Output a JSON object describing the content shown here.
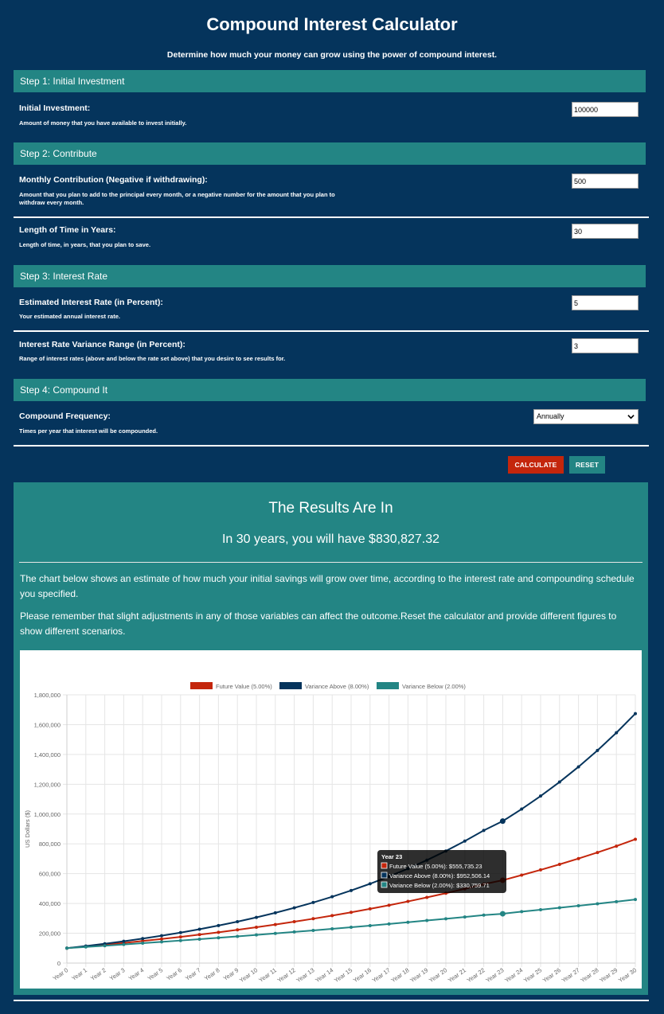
{
  "header": {
    "title": "Compound Interest Calculator",
    "subtitle": "Determine how much your money can grow using the power of compound interest."
  },
  "steps": {
    "step1": "Step 1: Initial Investment",
    "step2": "Step 2: Contribute",
    "step3": "Step 3: Interest Rate",
    "step4": "Step 4: Compound It"
  },
  "fields": {
    "initial_investment": {
      "label": "Initial Investment:",
      "desc": "Amount of money that you have available to invest initially.",
      "value": "100000"
    },
    "monthly_contribution": {
      "label": "Monthly Contribution (Negative if withdrawing):",
      "desc": "Amount that you plan to add to the principal every month, or a negative number for the amount that you plan to withdraw every month.",
      "value": "500"
    },
    "years": {
      "label": "Length of Time in Years:",
      "desc": "Length of time, in years, that you plan to save.",
      "value": "30"
    },
    "interest_rate": {
      "label": "Estimated Interest Rate (in Percent):",
      "desc": "Your estimated annual interest rate.",
      "value": "5"
    },
    "variance": {
      "label": "Interest Rate Variance Range (in Percent):",
      "desc": "Range of interest rates (above and below the rate set above) that you desire to see results for.",
      "value": "3"
    },
    "frequency": {
      "label": "Compound Frequency:",
      "desc": "Times per year that interest will be compounded.",
      "value": "Annually"
    }
  },
  "buttons": {
    "calculate": "CALCULATE",
    "reset": "RESET"
  },
  "results": {
    "title": "The Results Are In",
    "summary": "In 30 years, you will have $830,827.32",
    "paragraph1": "The chart below shows an estimate of how much your initial savings will grow over time, according to the interest rate and compounding schedule you specified.",
    "paragraph2": "Please remember that slight adjustments in any of those variables can affect the outcome.Reset the calculator and provide different figures to show different scenarios."
  },
  "colors": {
    "background": "#05345c",
    "accent": "#238584",
    "future": "#c4260c",
    "above": "#05345c",
    "below": "#238584"
  },
  "chart_data": {
    "type": "line",
    "ylabel": "US Dollars ($)",
    "ylim": [
      0,
      1800000
    ],
    "yticks": [
      "0",
      "200,000",
      "400,000",
      "600,000",
      "800,000",
      "1,000,000",
      "1,200,000",
      "1,400,000",
      "1,600,000",
      "1,800,000"
    ],
    "grid": true,
    "legend_position": "top",
    "categories": [
      "Year 0",
      "Year 1",
      "Year 2",
      "Year 3",
      "Year 4",
      "Year 5",
      "Year 6",
      "Year 7",
      "Year 8",
      "Year 9",
      "Year 10",
      "Year 11",
      "Year 12",
      "Year 13",
      "Year 14",
      "Year 15",
      "Year 16",
      "Year 17",
      "Year 18",
      "Year 19",
      "Year 20",
      "Year 21",
      "Year 22",
      "Year 23",
      "Year 24",
      "Year 25",
      "Year 26",
      "Year 27",
      "Year 28",
      "Year 29",
      "Year 30"
    ],
    "series": [
      {
        "name": "Future Value (5.00%)",
        "color": "#c4260c",
        "values": [
          100000,
          111150,
          122858,
          135150,
          148058,
          161611,
          175842,
          190784,
          206473,
          222947,
          240244,
          258406,
          277476,
          297500,
          318525,
          340601,
          363781,
          388120,
          413676,
          440510,
          468685,
          498270,
          529333,
          555735,
          590224,
          625437,
          662409,
          701229,
          741991,
          784790,
          830827
        ]
      },
      {
        "name": "Variance Above (8.00%)",
        "color": "#05345c",
        "values": [
          100000,
          114250,
          129640,
          146261,
          164212,
          183599,
          204537,
          227151,
          251573,
          277949,
          306435,
          337200,
          370426,
          406310,
          445065,
          486920,
          532124,
          580944,
          633670,
          690614,
          752113,
          818532,
          890264,
          952506,
          1033360,
          1120685,
          1214996,
          1316852,
          1426856,
          1545661,
          1673970
        ]
      },
      {
        "name": "Variance Below (2.00%)",
        "color": "#238584",
        "values": [
          100000,
          108120,
          116402,
          124850,
          133467,
          142257,
          151222,
          160367,
          169694,
          179208,
          188912,
          198811,
          208907,
          219205,
          229709,
          240423,
          251352,
          262499,
          273869,
          285467,
          297296,
          309362,
          321669,
          330760,
          345016,
          357916,
          371075,
          384496,
          398186,
          412150,
          426393
        ]
      }
    ],
    "tooltip": {
      "title": "Year 23",
      "index": 23,
      "lines": [
        "Future Value (5.00%): $555,735.23",
        "Variance Above (8.00%): $952,506.14",
        "Variance Below (2.00%): $330,759.71"
      ]
    }
  }
}
